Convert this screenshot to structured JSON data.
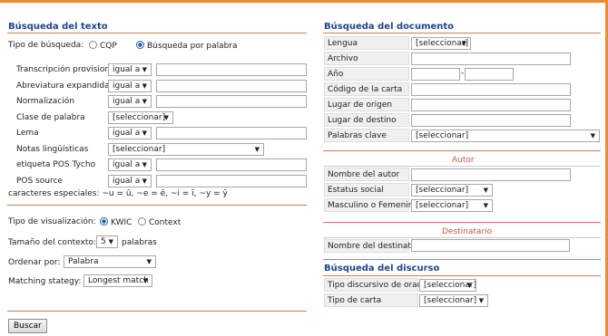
{
  "colors": {
    "accent": "#ef8b2c",
    "title": "#23448a",
    "sub_title": "#c4583c"
  },
  "left": {
    "title": "Búsqueda del texto",
    "tipo_busqueda": {
      "label": "Tipo de búsqueda:",
      "opt1": "CQP",
      "opt2": "Búsqueda por palabra",
      "selected": "Búsqueda por palabra"
    },
    "rows": [
      {
        "label": "Transcripción provisional",
        "op": "igual a"
      },
      {
        "label": "Abreviatura expandida",
        "op": "igual a"
      },
      {
        "label": "Normalización",
        "op": "igual a"
      },
      {
        "label": "Clase de palabra",
        "op": "[seleccionar]"
      },
      {
        "label": "Lema",
        "op": "igual a"
      },
      {
        "label": "Notas lingüísticas",
        "op": "[seleccionar]"
      },
      {
        "label": "etiqueta POS Tycho",
        "op": "igual a"
      },
      {
        "label": "POS source",
        "op": "igual a"
      }
    ],
    "especiales": "caracteres especiales: ~u = ū, ~e = ē, ~i = ī, ~y = ȳ",
    "visualizacion": {
      "label": "Tipo de visualización:",
      "opt1": "KWIC",
      "opt2": "Context",
      "selected": "KWIC"
    },
    "contexto": {
      "label": "Tamaño del contexto:",
      "value": "5",
      "suffix": "palabras"
    },
    "ordenar": {
      "label": "Ordenar por:",
      "value": "Palabra"
    },
    "matching": {
      "label": "Matching stategy:",
      "value": "Longest match"
    },
    "buscar": "Buscar"
  },
  "right": {
    "title": "Búsqueda del documento",
    "doc_rows": [
      {
        "label": "Lengua",
        "value": "[seleccionar]"
      },
      {
        "label": "Archivo"
      },
      {
        "label": "Año"
      },
      {
        "label": "Código de la carta"
      },
      {
        "label": "Lugar de origen"
      },
      {
        "label": "Lugar de destino"
      },
      {
        "label": "Palabras clave",
        "value": "[seleccionar]"
      }
    ],
    "autor": {
      "title": "Autor",
      "rows": [
        {
          "label": "Nombre del autor"
        },
        {
          "label": "Estatus social",
          "value": "[seleccionar]"
        },
        {
          "label": "Masculino o Femenino",
          "value": "[seleccionar]"
        }
      ]
    },
    "destinatario": {
      "title": "Destinatario",
      "label": "Nombre del destinatario"
    },
    "discurso": {
      "title": "Búsqueda del discurso",
      "rows": [
        {
          "label": "Tipo discursivo de oración",
          "value": "[seleccionar]"
        },
        {
          "label": "Tipo de carta",
          "value": "[seleccionar]"
        }
      ]
    }
  }
}
